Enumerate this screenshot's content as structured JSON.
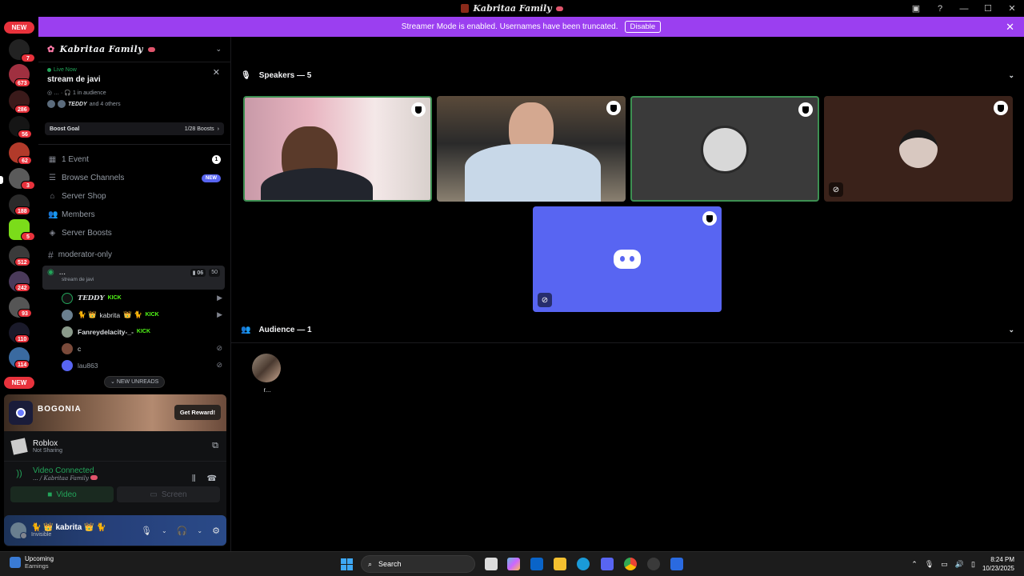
{
  "window": {
    "title": "Kabritaa Family"
  },
  "banner": {
    "text": "Streamer Mode is enabled. Usernames have been truncated.",
    "button": "Disable"
  },
  "servers": {
    "new_top": "NEW",
    "new_bottom": "NEW",
    "badges": [
      "7",
      "673",
      "286",
      "56",
      "62",
      "3",
      "188",
      "5",
      "512",
      "242",
      "93",
      "110",
      "114",
      "33"
    ]
  },
  "server_header": {
    "name": "Kabritaa Family"
  },
  "live": {
    "status": "Live Now",
    "title": "stream de javi",
    "audience": "1 in audience",
    "others_name": "TEDDY",
    "others_suffix": "and 4 others"
  },
  "boost": {
    "label": "Boost Goal",
    "progress": "1/28 Boosts"
  },
  "menu": [
    {
      "label": "1 Event",
      "badge": "1"
    },
    {
      "label": "Browse Channels",
      "badge": "NEW"
    },
    {
      "label": "Server Shop"
    },
    {
      "label": "Members"
    },
    {
      "label": "Server Boosts"
    }
  ],
  "channel": {
    "moderator": "moderator-only"
  },
  "voice_channel": {
    "name": "...",
    "subtitle": "stream de javi",
    "count_a": "06",
    "count_b": "50"
  },
  "voice_users": [
    {
      "name": "TEDDY",
      "tag": "KICK"
    },
    {
      "name": "kabrita",
      "tag": "KICK"
    },
    {
      "name": "Fanreydelacity-_-",
      "tag": "KICK"
    },
    {
      "name": "c"
    },
    {
      "name": "lau863"
    }
  ],
  "new_unreads": "NEW UNREADS",
  "promo": {
    "brand": "BOGONIA",
    "button": "Get Reward!"
  },
  "activity": {
    "game": "Roblox",
    "status": "Not Sharing"
  },
  "connection": {
    "status": "Video Connected",
    "location_prefix": "... /",
    "server": "Kabritaa Family"
  },
  "vbuttons": {
    "video": "Video",
    "screen": "Screen"
  },
  "user": {
    "name": "kabrita",
    "status": "Invisible"
  },
  "speakers": {
    "heading": "Speakers — 5"
  },
  "audience": {
    "heading": "Audience — 1",
    "user": "r..."
  },
  "taskbar": {
    "widget_title": "Upcoming",
    "widget_sub": "Earnings",
    "search": "Search",
    "time": "8:24 PM",
    "date": "10/23/2025",
    "notif_count": "3"
  }
}
